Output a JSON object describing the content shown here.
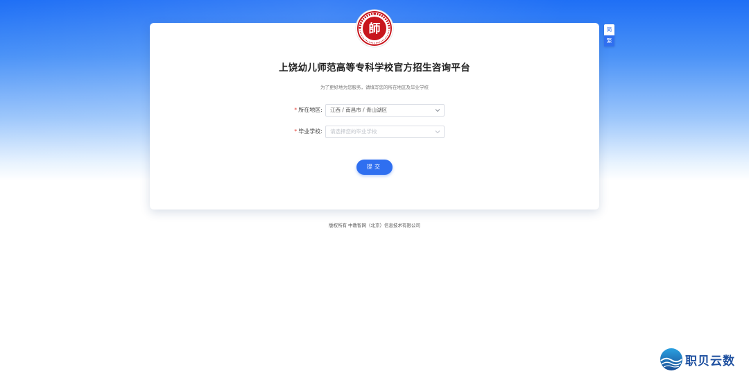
{
  "page": {
    "title": "上饶幼儿师范高等专科学校官方招生咨询平台",
    "subtitle": "为了更好地为您服务，请填写您的所在地区及毕业学校"
  },
  "logo": {
    "name": "school-seal-logo",
    "seal_text": "上饶幼儿师范高等专科学校"
  },
  "lang_switch": {
    "simplified": "简",
    "traditional": "繁"
  },
  "form": {
    "region": {
      "required_mark": "*",
      "label": "所在地区:",
      "value": "江西 / 南昌市 / 青山湖区"
    },
    "school": {
      "required_mark": "*",
      "label": "毕业学校:",
      "placeholder": "请选择您的毕业学校"
    },
    "submit_label": "提交"
  },
  "footer": {
    "copyright": "版权所有  中教智网（北京）信息技术有限公司"
  },
  "watermark": {
    "text": "职贝云数"
  },
  "colors": {
    "primary": "#2f6ff0",
    "required": "#e5483f",
    "seal_red": "#c8161d",
    "bg_top": "#1f6ff5"
  }
}
